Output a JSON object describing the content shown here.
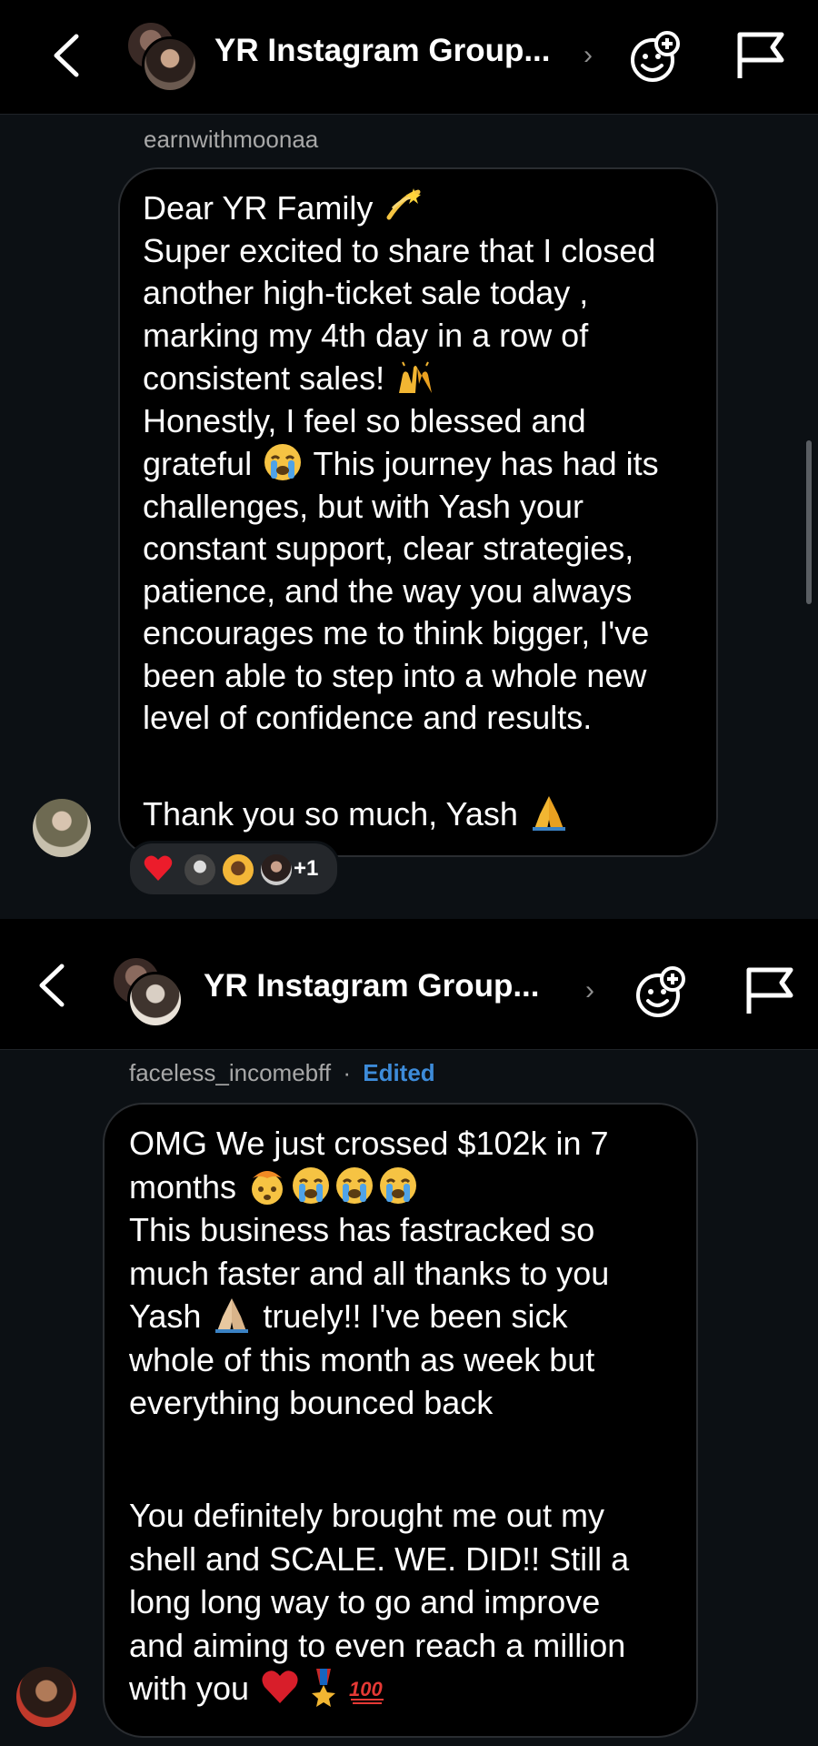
{
  "screens": [
    {
      "header": {
        "title": "YR Instagram Group..."
      },
      "message": {
        "sender": "earnwithmoonaa",
        "lines": [
          "Dear YR Family",
          "Super excited to share that I closed",
          "another high-ticket sale today ,",
          "marking my 4th day in a row of",
          "consistent sales!",
          "Honestly, I feel so blessed and",
          "grateful",
          "This journey has had its",
          "challenges, but with Yash your",
          "constant support, clear strategies,",
          "patience, and the way you always",
          "encourages me to think bigger, I've",
          "been able to step into a whole new",
          "level of confidence and results.",
          "Thank you so much, Yash"
        ],
        "reactions": {
          "emoji": "heart",
          "extra_count": "+1"
        }
      }
    },
    {
      "header": {
        "title": "YR Instagram Group..."
      },
      "message": {
        "sender": "faceless_incomebff",
        "separator": "·",
        "edited_label": "Edited",
        "lines": [
          "OMG We just crossed $102k in 7",
          "months",
          "This business has fastracked so",
          "much faster and all thanks to you",
          "Yash",
          "truely!! I've been sick",
          "whole of this month as week but",
          "everything bounced back",
          "You definitely brought me out my",
          "shell and SCALE. WE. DID!! Still a",
          "long long way to go and improve",
          "and aiming to even reach a million",
          "with you"
        ]
      }
    }
  ],
  "icons": [
    "back-arrow-icon",
    "chevron-right-icon",
    "add-emoji-icon",
    "flag-icon"
  ],
  "colors": {
    "background": "#0c1014",
    "header": "#000000",
    "edited": "#3d8bd9",
    "muted_text": "#a8a8a8"
  }
}
